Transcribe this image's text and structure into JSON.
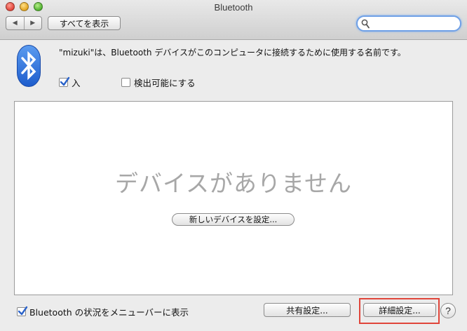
{
  "window": {
    "title": "Bluetooth"
  },
  "toolbar": {
    "back_glyph": "◀",
    "forward_glyph": "▶",
    "show_all_label": "すべてを表示",
    "search_value": ""
  },
  "header": {
    "description": "\"mizuki\"は、Bluetooth デバイスがこのコンピュータに接続するために使用する名前です。",
    "power_checkbox": {
      "label": "入",
      "checked": true
    },
    "discoverable_checkbox": {
      "label": "検出可能にする",
      "checked": false
    }
  },
  "device_list": {
    "empty_message": "デバイスがありません",
    "setup_button_label": "新しいデバイスを設定..."
  },
  "footer": {
    "menubar_checkbox": {
      "label": "Bluetooth の状況をメニューバーに表示",
      "checked": true
    },
    "sharing_button_label": "共有設定...",
    "advanced_button_label": "詳細設定...",
    "help_glyph": "?"
  },
  "colors": {
    "bluetooth_blue": "#2a6fd8",
    "highlight_red": "#e0453a",
    "checkbox_blue": "#3b7be0"
  },
  "icons": {
    "traffic_close": "close-icon",
    "traffic_min": "minimize-icon",
    "traffic_zoom": "zoom-icon",
    "search": "search-icon",
    "logo": "bluetooth-logo-icon"
  }
}
